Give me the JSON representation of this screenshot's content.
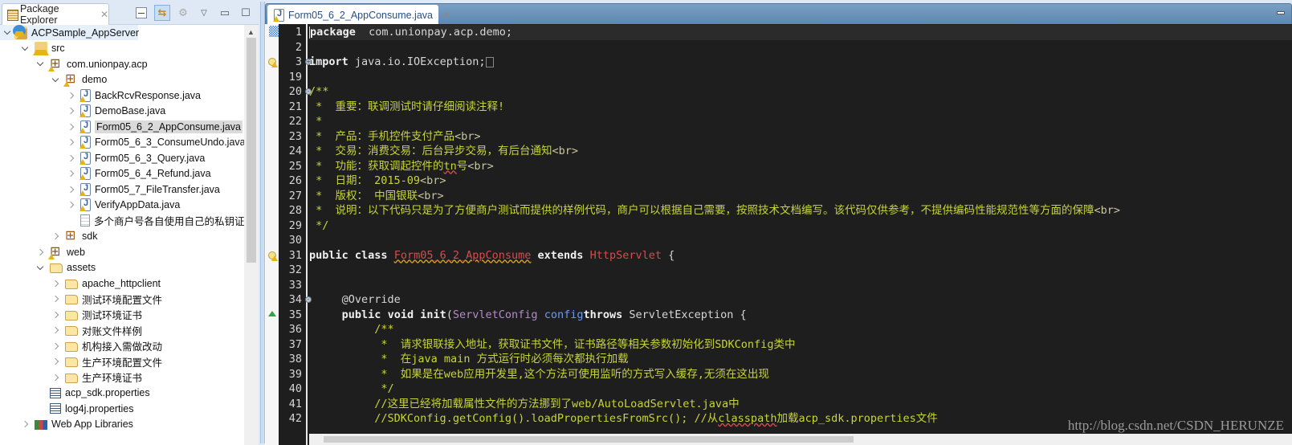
{
  "explorer": {
    "tab_label": "Package Explorer",
    "tree": [
      {
        "label": "ACPSample_AppServer",
        "depth": 0,
        "twisty": "open",
        "icon": "project-icon",
        "warn": true,
        "selected": true
      },
      {
        "label": "src",
        "depth": 1,
        "twisty": "open",
        "icon": "source-folder-icon",
        "warn": true
      },
      {
        "label": "com.unionpay.acp",
        "depth": 2,
        "twisty": "open",
        "icon": "package-icon",
        "warn": true
      },
      {
        "label": "demo",
        "depth": 3,
        "twisty": "open",
        "icon": "package-icon",
        "warn": true
      },
      {
        "label": "BackRcvResponse.java",
        "depth": 4,
        "twisty": "closed",
        "icon": "java-file-icon",
        "warn": true
      },
      {
        "label": "DemoBase.java",
        "depth": 4,
        "twisty": "closed",
        "icon": "java-file-icon",
        "warn": true
      },
      {
        "label": "Form05_6_2_AppConsume.java",
        "depth": 4,
        "twisty": "closed",
        "icon": "java-file-icon",
        "warn": true,
        "highlighted": true
      },
      {
        "label": "Form05_6_3_ConsumeUndo.java",
        "depth": 4,
        "twisty": "closed",
        "icon": "java-file-icon",
        "warn": true
      },
      {
        "label": "Form05_6_3_Query.java",
        "depth": 4,
        "twisty": "closed",
        "icon": "java-file-icon",
        "warn": true
      },
      {
        "label": "Form05_6_4_Refund.java",
        "depth": 4,
        "twisty": "closed",
        "icon": "java-file-icon",
        "warn": true
      },
      {
        "label": "Form05_7_FileTransfer.java",
        "depth": 4,
        "twisty": "closed",
        "icon": "java-file-icon",
        "warn": true
      },
      {
        "label": "VerifyAppData.java",
        "depth": 4,
        "twisty": "closed",
        "icon": "java-file-icon",
        "warn": true
      },
      {
        "label": "多个商户号各自使用自己的私钥证书",
        "depth": 4,
        "twisty": "none",
        "icon": "text-file-icon",
        "warn": false
      },
      {
        "label": "sdk",
        "depth": 3,
        "twisty": "closed",
        "icon": "package-icon",
        "warn": false
      },
      {
        "label": "web",
        "depth": 2,
        "twisty": "closed",
        "icon": "package-icon",
        "warn": true
      },
      {
        "label": "assets",
        "depth": 2,
        "twisty": "open",
        "icon": "folder-icon",
        "warn": false
      },
      {
        "label": "apache_httpclient",
        "depth": 3,
        "twisty": "closed",
        "icon": "folder-icon",
        "warn": false
      },
      {
        "label": "测试环境配置文件",
        "depth": 3,
        "twisty": "closed",
        "icon": "folder-icon",
        "warn": false
      },
      {
        "label": "测试环境证书",
        "depth": 3,
        "twisty": "closed",
        "icon": "folder-icon",
        "warn": false
      },
      {
        "label": "对账文件样例",
        "depth": 3,
        "twisty": "closed",
        "icon": "folder-icon",
        "warn": false
      },
      {
        "label": "机构接入需做改动",
        "depth": 3,
        "twisty": "closed",
        "icon": "folder-icon",
        "warn": false
      },
      {
        "label": "生产环境配置文件",
        "depth": 3,
        "twisty": "closed",
        "icon": "folder-icon",
        "warn": false
      },
      {
        "label": "生产环境证书",
        "depth": 3,
        "twisty": "closed",
        "icon": "folder-icon",
        "warn": false
      },
      {
        "label": "acp_sdk.properties",
        "depth": 2,
        "twisty": "none",
        "icon": "properties-file-icon",
        "warn": false
      },
      {
        "label": "log4j.properties",
        "depth": 2,
        "twisty": "none",
        "icon": "properties-file-icon",
        "warn": false
      },
      {
        "label": "Web App Libraries",
        "depth": 1,
        "twisty": "closed",
        "icon": "libraries-icon",
        "warn": false
      }
    ]
  },
  "editor": {
    "tab_label": "Form05_6_2_AppConsume.java",
    "lines": [
      {
        "n": "1",
        "current": true,
        "segs": [
          [
            "kw",
            "package"
          ],
          [
            "",
            "  com.unionpay.acp.demo;"
          ]
        ]
      },
      {
        "n": "2",
        "segs": []
      },
      {
        "n": "3",
        "fold": "+",
        "marker": "bulb",
        "segs": [
          [
            "kw",
            "import"
          ],
          [
            "",
            " java.io.IOException;"
          ],
          [
            "foldbox",
            ""
          ]
        ]
      },
      {
        "n": "19",
        "segs": []
      },
      {
        "n": "20",
        "fold": "-",
        "segs": [
          [
            "cm",
            "/**"
          ]
        ]
      },
      {
        "n": "21",
        "segs": [
          [
            "cm",
            " *  重要：联调测试时请仔细阅读注释!"
          ]
        ]
      },
      {
        "n": "22",
        "segs": [
          [
            "cm",
            " *"
          ]
        ]
      },
      {
        "n": "23",
        "segs": [
          [
            "cm",
            " *  产品：手机控件支付产品"
          ],
          [
            "cm-tag",
            "<br>"
          ]
        ]
      },
      {
        "n": "24",
        "segs": [
          [
            "cm",
            " *  交易：消费交易：后台异步交易，有后台通知"
          ],
          [
            "cm-tag",
            "<br>"
          ]
        ]
      },
      {
        "n": "25",
        "segs": [
          [
            "cm",
            " *  功能：获取调起控件的"
          ],
          [
            "cm sq",
            "tn"
          ],
          [
            "cm",
            "号"
          ],
          [
            "cm-tag",
            "<br>"
          ]
        ]
      },
      {
        "n": "26",
        "segs": [
          [
            "cm",
            " *  日期： 2015-09"
          ],
          [
            "cm-tag",
            "<br>"
          ]
        ]
      },
      {
        "n": "27",
        "segs": [
          [
            "cm",
            " *  版权： 中国银联"
          ],
          [
            "cm-tag",
            "<br>"
          ]
        ]
      },
      {
        "n": "28",
        "segs": [
          [
            "cm",
            " *  说明：以下代码只是为了方便商户测试而提供的样例代码，商户可以根据自己需要，按照技术文档编写。该代码仅供参考，不提供编码性能规范性等方面的保障"
          ],
          [
            "cm-tag",
            "<br>"
          ]
        ]
      },
      {
        "n": "29",
        "segs": [
          [
            "cm",
            " */"
          ]
        ]
      },
      {
        "n": "30",
        "segs": []
      },
      {
        "n": "31",
        "marker": "bulb",
        "segs": [
          [
            "kw",
            "public"
          ],
          [
            "",
            " "
          ],
          [
            "kw",
            "class"
          ],
          [
            "",
            " "
          ],
          [
            "cls-u",
            "Form05_6_2_AppConsume"
          ],
          [
            "",
            " "
          ],
          [
            "kw",
            "extends"
          ],
          [
            "",
            " "
          ],
          [
            "cls",
            "HttpServlet"
          ],
          [
            "",
            " {"
          ]
        ]
      },
      {
        "n": "32",
        "segs": []
      },
      {
        "n": "33",
        "segs": []
      },
      {
        "n": "34",
        "fold": "-",
        "segs": [
          [
            "",
            "     "
          ],
          [
            "ann",
            "@Override"
          ]
        ]
      },
      {
        "n": "35",
        "marker": "override",
        "segs": [
          [
            "",
            "     "
          ],
          [
            "kw",
            "public"
          ],
          [
            "",
            " "
          ],
          [
            "kw",
            "void"
          ],
          [
            "",
            " "
          ],
          [
            "kw",
            "init"
          ],
          [
            "",
            "("
          ],
          [
            "typ",
            "ServletConfig"
          ],
          [
            "",
            " "
          ],
          [
            "par",
            "config"
          ],
          [
            ") "
          ],
          [
            "kw",
            "throws"
          ],
          [
            "",
            " ServletException {"
          ]
        ]
      },
      {
        "n": "36",
        "segs": [
          [
            "",
            "          "
          ],
          [
            "cm",
            "/**"
          ]
        ]
      },
      {
        "n": "37",
        "segs": [
          [
            "",
            "          "
          ],
          [
            "cm",
            " *  请求银联接入地址，获取证书文件，证书路径等相关参数初始化到SDKConfig类中"
          ]
        ]
      },
      {
        "n": "38",
        "segs": [
          [
            "",
            "          "
          ],
          [
            "cm",
            " *  在java main 方式运行时必须每次都执行加载"
          ]
        ]
      },
      {
        "n": "39",
        "segs": [
          [
            "",
            "          "
          ],
          [
            "cm",
            " *  如果是在web应用开发里,这个方法可使用监听的方式写入缓存,无须在这出现"
          ]
        ]
      },
      {
        "n": "40",
        "segs": [
          [
            "",
            "          "
          ],
          [
            "cm",
            " */"
          ]
        ]
      },
      {
        "n": "41",
        "segs": [
          [
            "",
            "          "
          ],
          [
            "cm",
            "//这里已经将加载属性文件的方法挪到了web/AutoLoadServlet.java中"
          ]
        ]
      },
      {
        "n": "42",
        "segs": [
          [
            "",
            "          "
          ],
          [
            "cm",
            "//SDKConfig.getConfig().loadPropertiesFromSrc(); //从"
          ],
          [
            "cm sq",
            "classpath"
          ],
          [
            "cm",
            "加载acp_sdk.properties文件"
          ]
        ]
      }
    ]
  },
  "watermark": "http://blog.csdn.net/CSDN_HERUNZE"
}
